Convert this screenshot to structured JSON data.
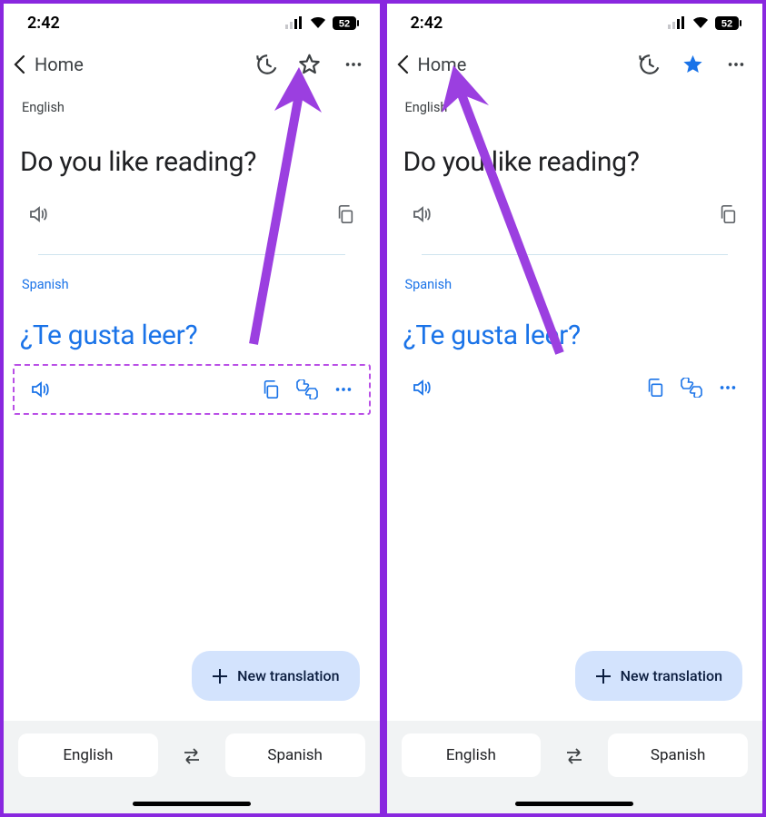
{
  "screens": {
    "left": {
      "status_time": "2:42",
      "battery_text": "52",
      "nav_title": "Home",
      "star_filled": false,
      "src_lang_label": "English",
      "src_text": "Do you like reading?",
      "dst_lang_label": "Spanish",
      "dst_text": "¿Te gusta leer?",
      "show_action_highlight": true,
      "fab_label": "New translation",
      "bottom_src_lang": "English",
      "bottom_dst_lang": "Spanish"
    },
    "right": {
      "status_time": "2:42",
      "battery_text": "52",
      "nav_title": "Home",
      "star_filled": true,
      "src_lang_label": "English",
      "src_text": "Do you like reading?",
      "dst_lang_label": "Spanish",
      "dst_text": "¿Te gusta leer?",
      "show_action_highlight": false,
      "fab_label": "New translation",
      "bottom_src_lang": "English",
      "bottom_dst_lang": "Spanish"
    }
  },
  "colors": {
    "accent": "#1a73e8",
    "annotation": "#9b3fe0"
  }
}
